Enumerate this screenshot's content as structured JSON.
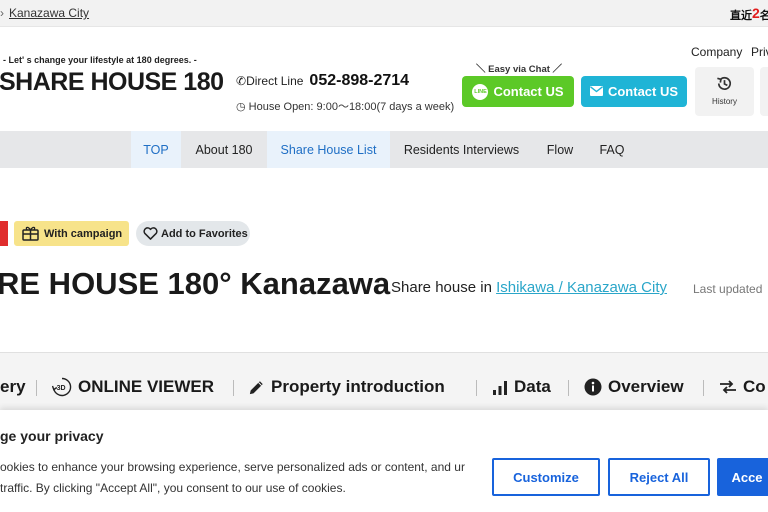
{
  "topbar": {
    "breadcrumb_sep": "›",
    "breadcrumb_current": "Kanazawa City",
    "promo_prefix": "直近",
    "promo_number": "2",
    "promo_suffix": "名"
  },
  "header": {
    "tagline": "- Let' s change your lifestyle at 180 degrees. -",
    "logo": "SHARE HOUSE 180",
    "phone_label": "Direct Line",
    "phone_number": "052-898-2714",
    "hours": "House Open: 9:00～18:00(7 days a week)",
    "easy_chat": "＼ Easy via Chat ／",
    "line_badge": "LINE",
    "line_button": "Contact US",
    "mail_button": "Contact US",
    "company_link": "Company",
    "privacy_link": "Priv",
    "history_label": "History"
  },
  "nav": {
    "items": [
      {
        "label": "TOP"
      },
      {
        "label": "About 180"
      },
      {
        "label": "Share House List"
      },
      {
        "label": "Residents Interviews"
      },
      {
        "label": "Flow"
      },
      {
        "label": "FAQ"
      }
    ]
  },
  "property": {
    "campaign_badge": "With campaign",
    "favorites_button": "Add to Favorites",
    "title": "RE HOUSE 180° Kanazawa",
    "subtitle_prefix": "Share house in ",
    "location_link": "Ishikawa / Kanazawa City",
    "last_updated": "Last updated"
  },
  "section_tabs": [
    {
      "label": "ery"
    },
    {
      "label": "ONLINE VIEWER"
    },
    {
      "label": "Property introduction"
    },
    {
      "label": "Data"
    },
    {
      "label": "Overview"
    },
    {
      "label": "Co"
    }
  ],
  "cookie": {
    "title": "ge your privacy",
    "text": "ookies to enhance your browsing experience, serve personalized ads or content, and ur traffic. By clicking \"Accept All\", you consent to our use of cookies.",
    "customize": "Customize",
    "reject": "Reject All",
    "accept": "Acce"
  },
  "colors": {
    "line_green": "#5cc927",
    "mail_blue": "#1fb4d6",
    "nav_active": "#1f6fc5",
    "campaign_yellow": "#f7e38a",
    "link_teal": "#2aa6c9",
    "cookie_blue": "#1863dc"
  }
}
